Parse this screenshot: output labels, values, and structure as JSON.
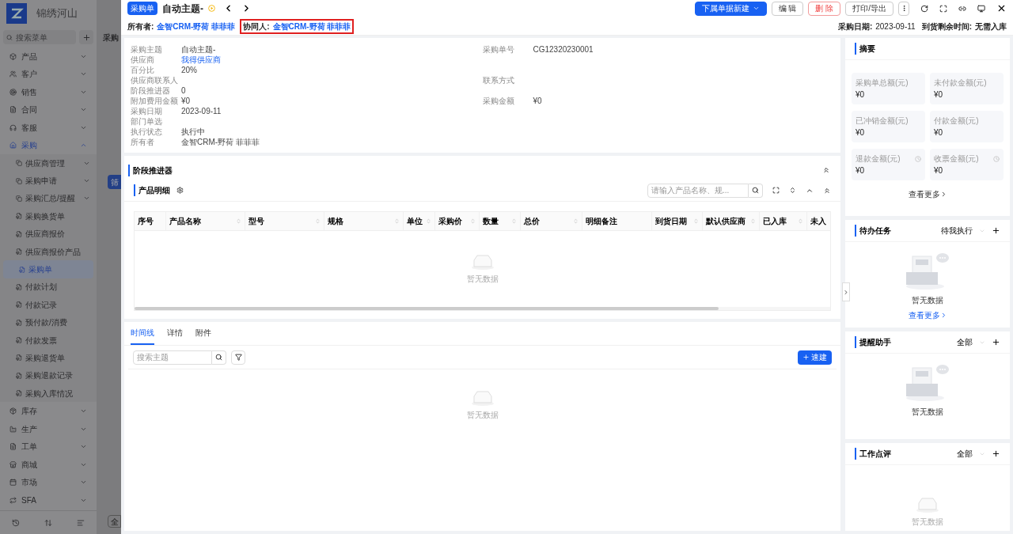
{
  "sidebar": {
    "logo_text": "锦绣河山",
    "search_placeholder": "搜索菜单",
    "items": [
      {
        "label": "产品",
        "expanded": false,
        "selected": false
      },
      {
        "label": "客户",
        "expanded": false,
        "selected": false
      },
      {
        "label": "销售",
        "expanded": false,
        "selected": false
      },
      {
        "label": "合同",
        "expanded": false,
        "selected": false
      },
      {
        "label": "客服",
        "expanded": false,
        "selected": false
      },
      {
        "label": "采购",
        "expanded": true,
        "selected": true,
        "children": [
          {
            "label": "供应商管理",
            "kind": "group",
            "selected": false
          },
          {
            "label": "采购申请",
            "kind": "group",
            "selected": false
          },
          {
            "label": "采购汇总/提醒",
            "kind": "group",
            "selected": false
          },
          {
            "label": "采购换货单",
            "kind": "page",
            "selected": false
          },
          {
            "label": "供应商报价",
            "kind": "page",
            "selected": false
          },
          {
            "label": "供应商报价产品",
            "kind": "page",
            "selected": false
          },
          {
            "label": "采购单",
            "kind": "page",
            "selected": true
          },
          {
            "label": "付款计划",
            "kind": "page",
            "selected": false
          },
          {
            "label": "付款记录",
            "kind": "page",
            "selected": false
          },
          {
            "label": "预付款/消费",
            "kind": "page",
            "selected": false
          },
          {
            "label": "付款发票",
            "kind": "page",
            "selected": false
          },
          {
            "label": "采购退货单",
            "kind": "page",
            "selected": false
          },
          {
            "label": "采购退款记录",
            "kind": "page",
            "selected": false
          },
          {
            "label": "采购入库情况",
            "kind": "page",
            "selected": false
          }
        ]
      },
      {
        "label": "库存",
        "expanded": false,
        "selected": false
      },
      {
        "label": "生产",
        "expanded": false,
        "selected": false
      },
      {
        "label": "工单",
        "expanded": false,
        "selected": false
      },
      {
        "label": "商城",
        "expanded": false,
        "selected": false
      },
      {
        "label": "市场",
        "expanded": false,
        "selected": false
      },
      {
        "label": "SFA",
        "expanded": false,
        "selected": false
      }
    ]
  },
  "background_page": {
    "title": "采购",
    "filter_button": "筛",
    "bottom_button": "全"
  },
  "header": {
    "badge": "采购单",
    "title": "自动主题-",
    "buttons": [
      {
        "label": "下属单据新建",
        "kind": "primary"
      },
      {
        "label": "编 辑",
        "kind": "default"
      },
      {
        "label": "删 除",
        "kind": "danger"
      },
      {
        "label": "打印/导出",
        "kind": "default"
      }
    ],
    "owner_label": "所有者:",
    "owner": "金智CRM-野荷 菲菲菲",
    "collaborator_label": "协同人:",
    "collaborator": "金智CRM-野荷 菲菲菲",
    "date_label": "采购日期:",
    "date": "2023-09-11",
    "remaining_label": "到货剩余时间:",
    "remaining": "无需入库"
  },
  "details": [
    {
      "left": {
        "label": "采购主题",
        "value": "自动主题-"
      },
      "right": {
        "label": "采购单号",
        "value": "CG12320230001"
      }
    },
    {
      "left": {
        "label": "供应商",
        "value": "我得供应商",
        "link": true
      }
    },
    {
      "left": {
        "label": "百分比",
        "value": "20%"
      }
    },
    {
      "left": {
        "label": "供应商联系人"
      },
      "right": {
        "label": "联系方式"
      }
    },
    {
      "left": {
        "label": "阶段推进器",
        "value": "0"
      }
    },
    {
      "left": {
        "label": "附加费用金额",
        "value": "¥0"
      },
      "right": {
        "label": "采购金额",
        "value": "¥0"
      }
    },
    {
      "left": {
        "label": "采购日期",
        "value": "2023-09-11"
      }
    },
    {
      "left": {
        "label": "部门单选"
      }
    },
    {
      "left": {
        "label": "执行状态",
        "value": "执行中"
      }
    },
    {
      "left": {
        "label": "所有者",
        "value": "金智CRM-野荷 菲菲菲"
      }
    }
  ],
  "stage": {
    "title": "阶段推进器"
  },
  "products": {
    "title": "产品明细",
    "search_placeholder": "请输入产品名称、规...",
    "empty": "暂无数据",
    "columns": [
      {
        "label": "序号",
        "sortable": false
      },
      {
        "label": "产品名称",
        "sortable": true
      },
      {
        "label": "型号",
        "sortable": true
      },
      {
        "label": "规格",
        "sortable": true
      },
      {
        "label": "单位",
        "sortable": true
      },
      {
        "label": "采购价",
        "sortable": true
      },
      {
        "label": "数量",
        "sortable": true
      },
      {
        "label": "总价",
        "sortable": true
      },
      {
        "label": "明细备注",
        "sortable": false
      },
      {
        "label": "到货日期",
        "sortable": true
      },
      {
        "label": "默认供应商",
        "sortable": true
      },
      {
        "label": "已入库",
        "sortable": true
      },
      {
        "label": "未入"
      }
    ]
  },
  "activity": {
    "tabs": [
      {
        "label": "时间线",
        "selected": true
      },
      {
        "label": "详情",
        "selected": false
      },
      {
        "label": "附件",
        "selected": false
      }
    ],
    "search_placeholder": "搜索主题",
    "new_button": "速建",
    "empty": "暂无数据"
  },
  "summary": {
    "title": "摘要",
    "stats": [
      {
        "label": "采购单总额(元)",
        "value": "¥0",
        "info": false
      },
      {
        "label": "未付款金额(元)",
        "value": "¥0",
        "info": false
      },
      {
        "label": "已冲销金额(元)",
        "value": "¥0",
        "info": false
      },
      {
        "label": "付款金额(元)",
        "value": "¥0",
        "info": false
      },
      {
        "label": "退款金额(元)",
        "value": "¥0",
        "info": true
      },
      {
        "label": "收票金额(元)",
        "value": "¥0",
        "info": true
      }
    ],
    "more": "查看更多"
  },
  "cards": [
    {
      "title": "待办任务",
      "filter": "待我执行",
      "empty": "暂无数据",
      "more": "查看更多",
      "kind": "illustrated"
    },
    {
      "title": "提醒助手",
      "filter": "全部",
      "empty": "暂无数据",
      "kind": "illustrated"
    },
    {
      "title": "工作点评",
      "filter": "全部",
      "empty": "暂无数据",
      "kind": "plain"
    }
  ]
}
